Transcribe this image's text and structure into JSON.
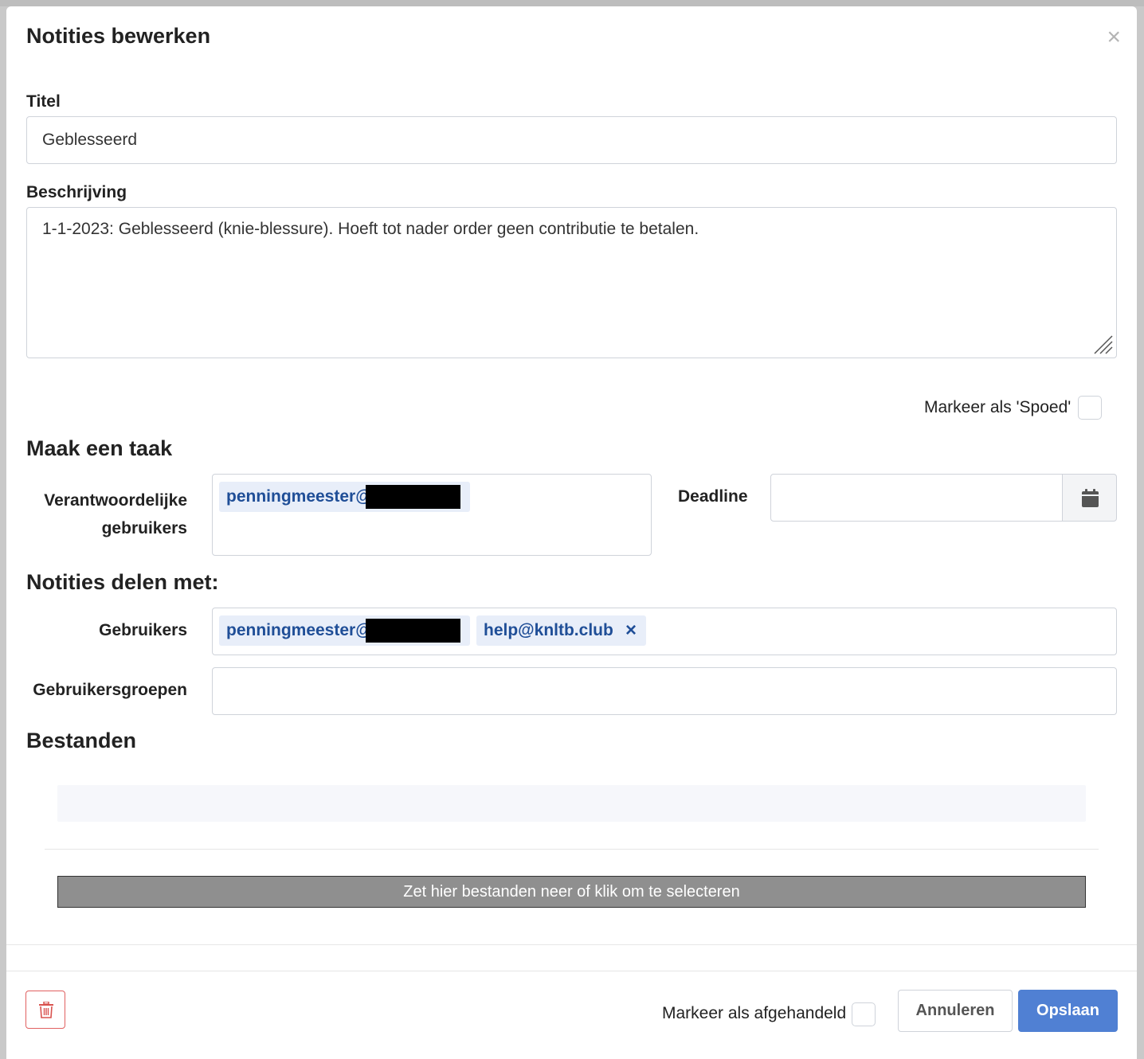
{
  "modal": {
    "title": "Notities bewerken",
    "close_glyph": "×"
  },
  "form": {
    "title_label": "Titel",
    "title_value": "Geblesseerd",
    "description_label": "Beschrijving",
    "description_value": "1-1-2023: Geblesseerd (knie-blessure). Hoeft tot nader order geen contributie te betalen.",
    "urgent_label": "Markeer als 'Spoed'",
    "urgent_checked": false
  },
  "task": {
    "heading": "Maak een taak",
    "responsible_label_line1": "Verantwoordelijke",
    "responsible_label_line2": "gebruikers",
    "responsible_tags": [
      {
        "text": "penningmeester@",
        "redacted": true
      }
    ],
    "deadline_label": "Deadline",
    "deadline_value": "",
    "calendar_icon": "calendar-icon"
  },
  "share": {
    "heading": "Notities delen met:",
    "users_label": "Gebruikers",
    "user_tags": [
      {
        "text": "penningmeester@",
        "redacted": true
      },
      {
        "text": "help@knltb.club",
        "remove_glyph": "×"
      }
    ],
    "groups_label": "Gebruikersgroepen",
    "groups_value": ""
  },
  "files": {
    "heading": "Bestanden",
    "dropzone_text": "Zet hier bestanden neer of klik om te selecteren"
  },
  "footer": {
    "delete_icon": "trash-icon",
    "handled_label": "Markeer als afgehandeld",
    "handled_checked": false,
    "cancel_label": "Annuleren",
    "save_label": "Opslaan"
  },
  "colors": {
    "primary": "#5080d3",
    "tag_bg": "#e8eef9",
    "tag_text": "#1f4e97",
    "danger": "#e06060"
  }
}
